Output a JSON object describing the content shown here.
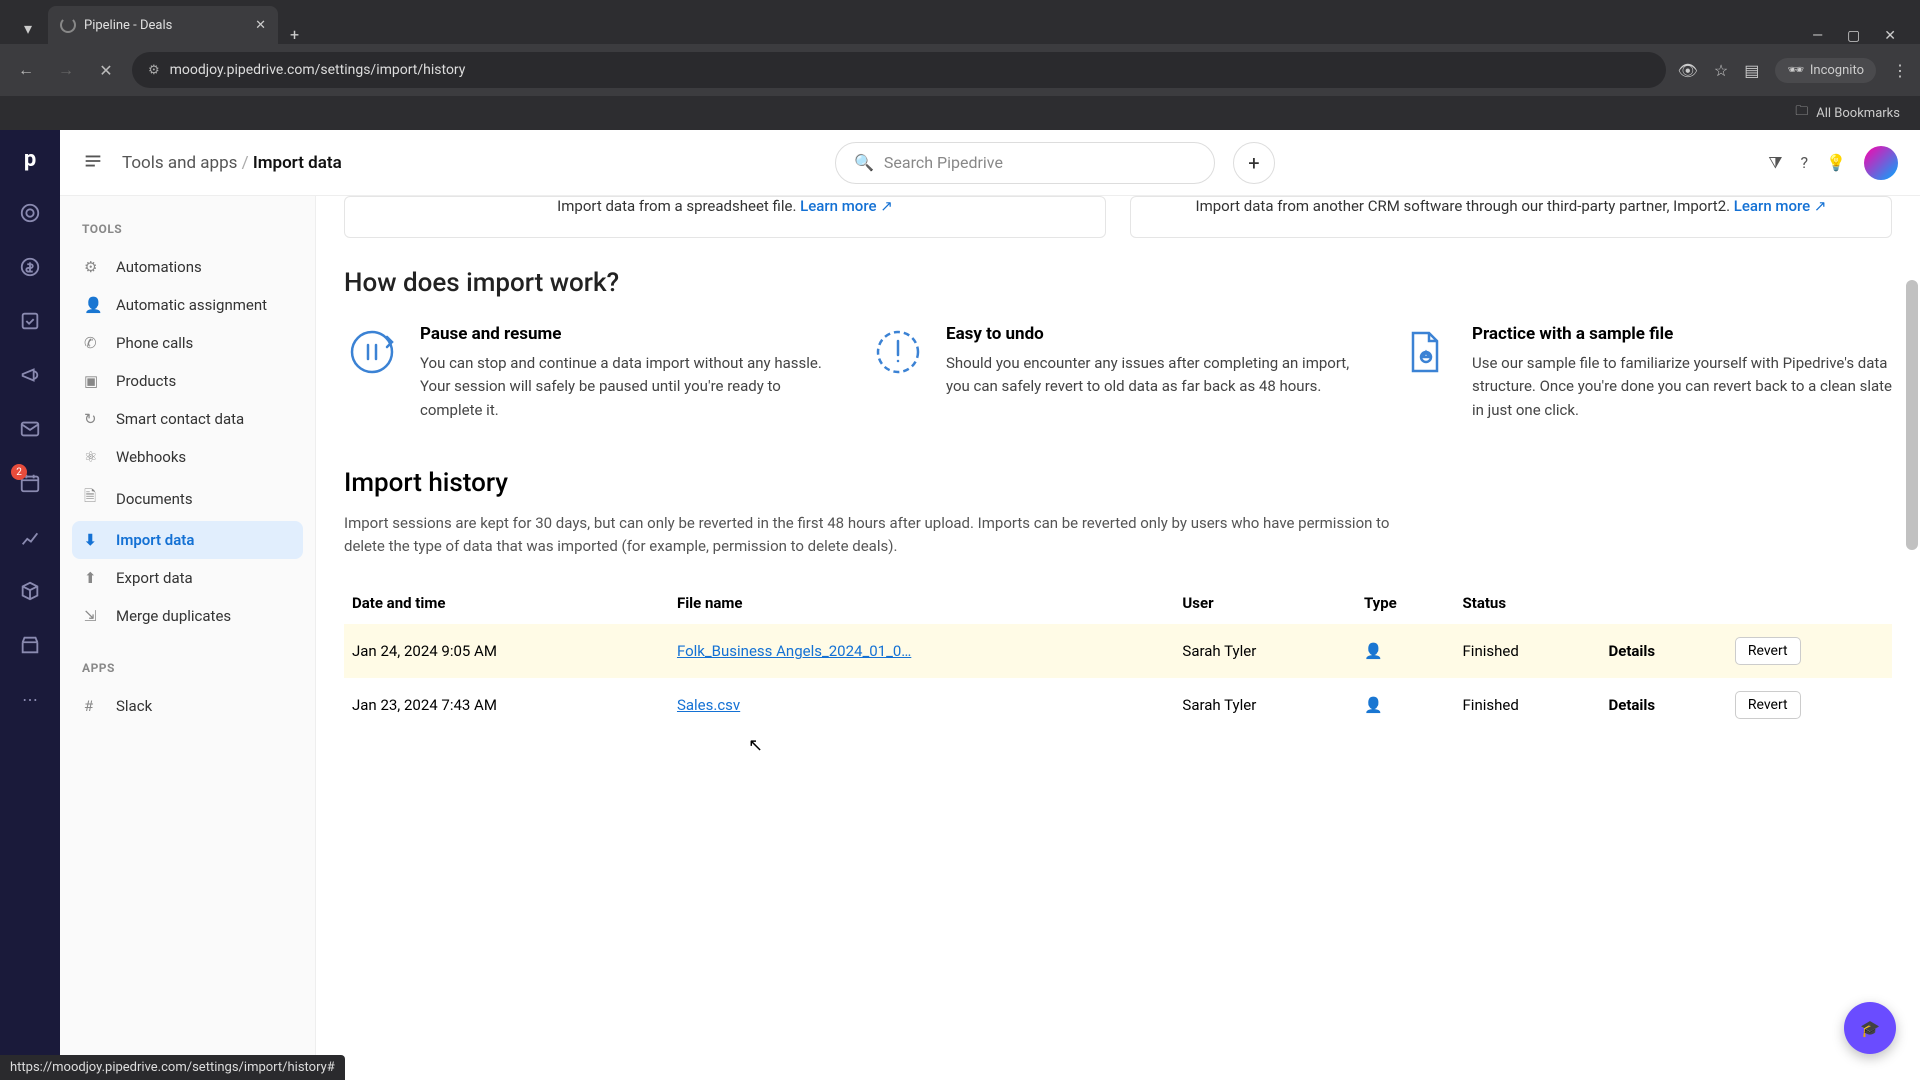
{
  "browser": {
    "tab_title": "Pipeline - Deals",
    "url": "moodjoy.pipedrive.com/settings/import/history",
    "incognito_label": "Incognito",
    "all_bookmarks": "All Bookmarks",
    "status_url": "https://moodjoy.pipedrive.com/settings/import/history#"
  },
  "rail": {
    "badge": "2"
  },
  "topbar": {
    "breadcrumb_parent": "Tools and apps",
    "breadcrumb_current": "Import data",
    "search_placeholder": "Search Pipedrive"
  },
  "sidebar": {
    "heading_tools": "TOOLS",
    "heading_apps": "APPS",
    "items": [
      {
        "label": "Automations"
      },
      {
        "label": "Automatic assignment"
      },
      {
        "label": "Phone calls"
      },
      {
        "label": "Products"
      },
      {
        "label": "Smart contact data"
      },
      {
        "label": "Webhooks"
      },
      {
        "label": "Documents"
      },
      {
        "label": "Import data"
      },
      {
        "label": "Export data"
      },
      {
        "label": "Merge duplicates"
      }
    ],
    "app_item": "Slack"
  },
  "cards": {
    "spreadsheet_text": "Import data from a spreadsheet file. ",
    "spreadsheet_link": "Learn more",
    "crm_text": "Import data from another CRM software through our third-party partner, Import2. ",
    "crm_link": "Learn more"
  },
  "howto": {
    "title": "How does import work?",
    "features": [
      {
        "title": "Pause and resume",
        "body": "You can stop and continue a data import without any hassle. Your session will safely be paused until you're ready to complete it."
      },
      {
        "title": "Easy to undo",
        "body": "Should you encounter any issues after completing an import, you can safely revert to old data as far back as 48 hours."
      },
      {
        "title": "Practice with a sample file",
        "body": "Use our sample file to familiarize yourself with Pipedrive's data structure. Once you're done you can revert back to a clean slate in just one click."
      }
    ]
  },
  "history": {
    "title": "Import history",
    "desc": "Import sessions are kept for 30 days, but can only be reverted in the first 48 hours after upload. Imports can be reverted only by users who have permission to delete the type of data that was imported (for example, permission to delete deals).",
    "columns": {
      "date": "Date and time",
      "file": "File name",
      "user": "User",
      "type": "Type",
      "status": "Status"
    },
    "details_label": "Details",
    "revert_label": "Revert",
    "rows": [
      {
        "date": "Jan 24, 2024 9:05 AM",
        "file": "Folk_Business Angels_2024_01_0…",
        "user": "Sarah Tyler",
        "status": "Finished"
      },
      {
        "date": "Jan 23, 2024 7:43 AM",
        "file": "Sales.csv",
        "user": "Sarah Tyler",
        "status": "Finished"
      }
    ]
  }
}
